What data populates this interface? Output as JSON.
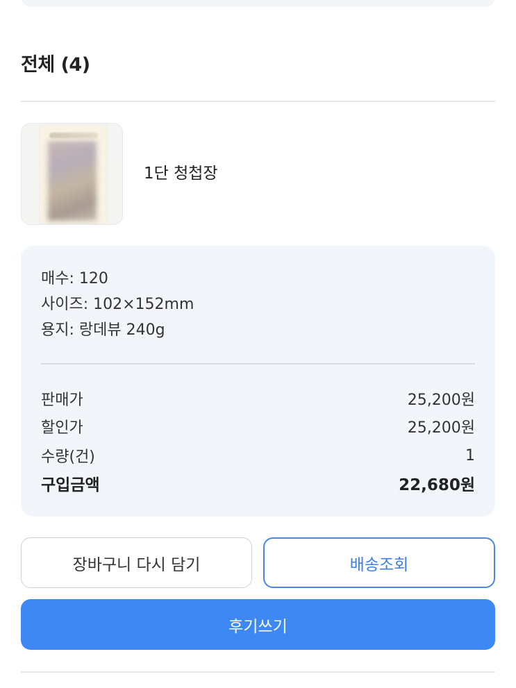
{
  "section": {
    "title": "전체 (4)"
  },
  "product": {
    "name": "1단 청첩장",
    "thumbnail_icon": "product-thumbnail"
  },
  "options": [
    "매수: 120",
    "사이즈: 102×152mm",
    "용지: 랑데뷰 240g"
  ],
  "price": {
    "rows": [
      {
        "label": "판매가",
        "value": "25,200원"
      },
      {
        "label": "할인가",
        "value": "25,200원"
      },
      {
        "label": "수량(건)",
        "value": "1"
      },
      {
        "label": "구입금액",
        "value": "22,680원"
      }
    ]
  },
  "buttons": {
    "cart": "장바구니 다시 담기",
    "track": "배송조회",
    "review": "후기쓰기"
  },
  "colors": {
    "accent": "#3e88f3",
    "outline_accent": "#4a86e8",
    "panel": "#f2f5f9"
  }
}
